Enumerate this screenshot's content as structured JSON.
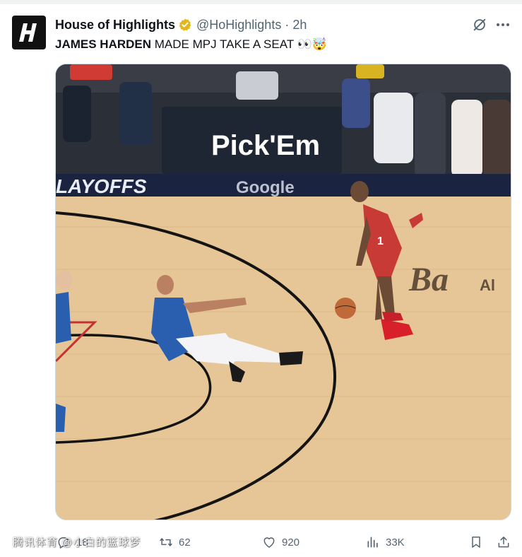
{
  "author": {
    "display_name": "House of Highlights",
    "handle": "@HoHighlights",
    "separator": "·",
    "time": "2h",
    "avatar_letter": "H"
  },
  "tweet": {
    "bold_text": "JAMES HARDEN",
    "text": " MADE MPJ TAKE A SEAT 👀🤯"
  },
  "media": {
    "scoreboard_text": "Pick'Em",
    "banner_left": "LAYOFFS",
    "banner_right": "Google",
    "floor_logo": "Ba",
    "floor_logo_sub": "Al",
    "jersey_number": "1"
  },
  "actions": {
    "reply_count": "18",
    "retweet_count": "62",
    "like_count": "920",
    "view_count": "33K"
  },
  "watermark": "腾讯体育 @小白的篮球梦",
  "colors": {
    "accent": "#1d9bf0",
    "verified_gold": "#e2b719",
    "muted": "#536471",
    "court": "#e8c79a"
  }
}
